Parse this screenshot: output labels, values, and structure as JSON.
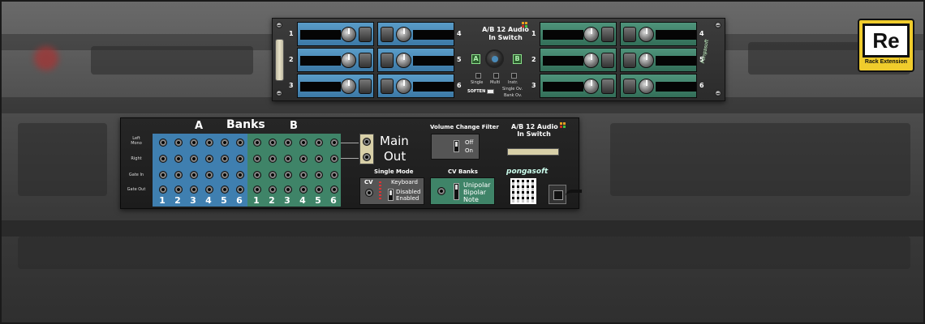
{
  "badge": {
    "logo": "Re",
    "caption": "Rack Extension"
  },
  "front": {
    "title_line1": "A/B 12 Audio",
    "title_line2": "In Switch",
    "a_label": "A",
    "b_label": "B",
    "mode_labels": [
      "Single",
      "Multi",
      "Instr."
    ],
    "single_ov": "Single Ov.",
    "bank_ov": "Bank Ov.",
    "soften": "SOFTEN",
    "brand": "Pongasoft",
    "row_numbers": [
      "1",
      "2",
      "3"
    ],
    "col_numbers": [
      "4",
      "5",
      "6"
    ]
  },
  "back": {
    "banks_label": "Banks",
    "bank_a": "A",
    "bank_b": "B",
    "row_labels": [
      "Left\nMono",
      "Right",
      "Gate In",
      "Gate Out"
    ],
    "bank_numbers": [
      "1",
      "2",
      "3",
      "4",
      "5",
      "6"
    ],
    "main_out": [
      "Main",
      "Out"
    ],
    "volume_filter_label": "Volume Change Filter",
    "volume_options": [
      "Off",
      "On"
    ],
    "title_line1": "A/B 12 Audio",
    "title_line2": "In Switch",
    "single_mode_label": "Single Mode",
    "cv_label": "CV",
    "keyboard_label": "Keyboard",
    "disabled_label": "Disabled",
    "enabled_label": "Enabled",
    "cv_banks_label": "CV Banks",
    "cv_options": [
      "Unipolar",
      "Bipolar",
      "Note"
    ],
    "brand": "pongasoft"
  },
  "colors": {
    "bank_a": "#3f7fb0",
    "bank_b": "#3f8468",
    "badge": "#f0cc2c"
  }
}
